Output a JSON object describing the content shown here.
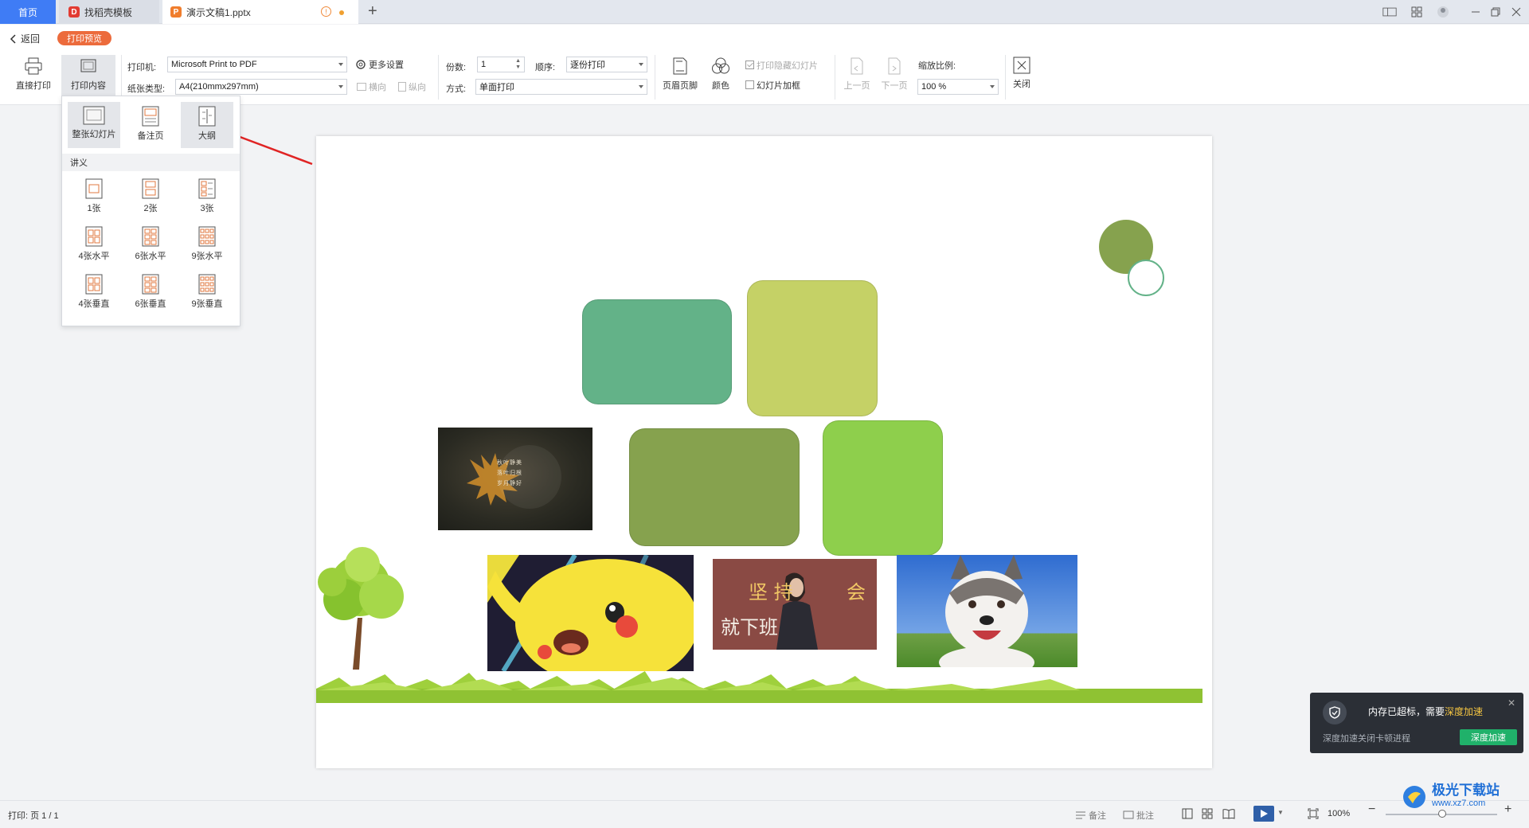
{
  "tabs": {
    "home": "首页",
    "templates": "找稻壳模板",
    "document": "演示文稿1.pptx"
  },
  "window": {
    "icons": [
      "layout-icon",
      "grid-icon",
      "avatar-icon",
      "minimize-icon",
      "restore-icon",
      "close-icon"
    ]
  },
  "header": {
    "back_label": "返回",
    "mode_badge": "打印预览"
  },
  "toolbar": {
    "direct_print": "直接打印",
    "print_content": "打印内容",
    "printer_label": "打印机:",
    "printer_value": "Microsoft Print to PDF",
    "paper_label": "纸张类型:",
    "paper_value": "A4(210mmx297mm)",
    "more_settings": "更多设置",
    "landscape": "横向",
    "portrait": "纵向",
    "copies_label": "份数:",
    "copies_value": "1",
    "order_label": "顺序:",
    "order_value": "逐份打印",
    "method_label": "方式:",
    "method_value": "单面打印",
    "header_footer": "页眉页脚",
    "color": "颜色",
    "print_hidden": "打印隐藏幻灯片",
    "slide_frame": "幻灯片加框",
    "prev_page": "上一页",
    "next_page": "下一页",
    "zoom_label": "缩放比例:",
    "zoom_value": "100 %",
    "close": "关闭"
  },
  "dropdown": {
    "top_items": [
      "整张幻灯片",
      "备注页",
      "大纲"
    ],
    "section": "讲义",
    "handouts": [
      "1张",
      "2张",
      "3张",
      "4张水平",
      "6张水平",
      "9张水平",
      "4张垂直",
      "6张垂直",
      "9张垂直"
    ]
  },
  "slide": {
    "poem_lines": [
      "秋叶静美",
      "落叶归根",
      "岁月静好"
    ],
    "banner_text_1": "坚 持",
    "banner_text_2": "会",
    "banner_text_3": "就下班"
  },
  "status": {
    "print_info": "打印: 页 1 / 1",
    "notes": "备注",
    "comments": "批注",
    "zoom": "100%"
  },
  "toast": {
    "message_prefix": "内存已超标，需要",
    "message_highlight": "深度加速",
    "sub": "深度加速关闭卡顿进程",
    "button": "深度加速"
  },
  "watermark": {
    "name": "极光下载站",
    "url": "www.xz7.com"
  },
  "colors": {
    "accent_blue": "#3f7cf5",
    "badge_orange": "#ec6b3c",
    "rect_teal": "#63b288",
    "rect_lime": "#c5d166",
    "rect_olive": "#86a24e",
    "rect_green": "#8ecf4c",
    "circle": "#86a24e",
    "toast_green": "#20b16a"
  }
}
